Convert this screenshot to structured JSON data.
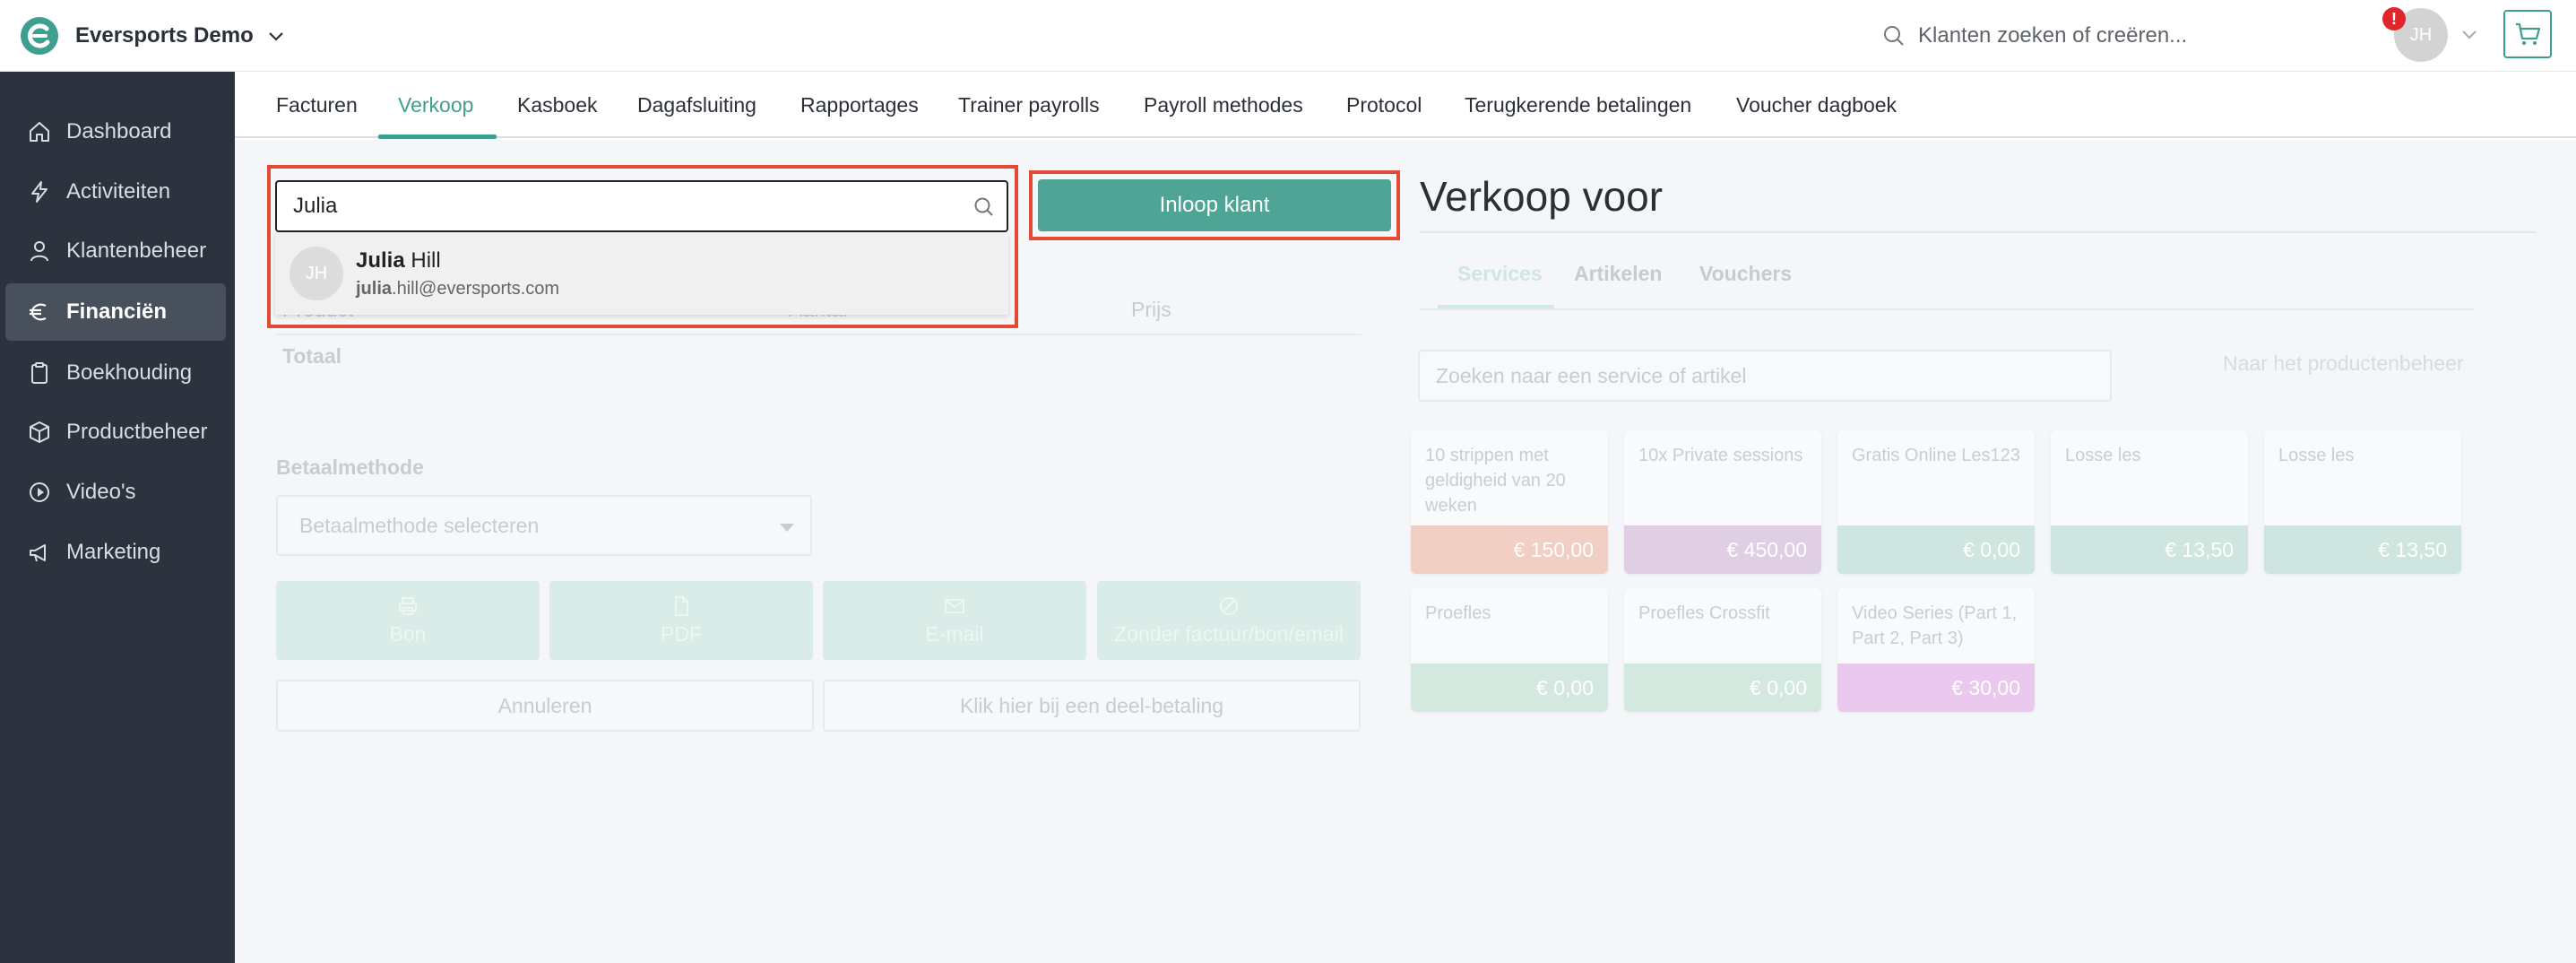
{
  "app": {
    "name": "Eversports Demo",
    "global_search_placeholder": "Klanten zoeken of creëren...",
    "user_initials": "JH",
    "notification_badge": "!",
    "brand_color": "#3f9f8f"
  },
  "sidebar": {
    "items": [
      {
        "label": "Dashboard",
        "icon": "home-icon",
        "active": false
      },
      {
        "label": "Activiteiten",
        "icon": "lightning-icon",
        "active": false
      },
      {
        "label": "Klantenbeheer",
        "icon": "user-icon",
        "active": false
      },
      {
        "label": "Financiën",
        "icon": "euro-icon",
        "active": true
      },
      {
        "label": "Boekhouding",
        "icon": "clipboard-icon",
        "active": false
      },
      {
        "label": "Productbeheer",
        "icon": "box-icon",
        "active": false
      },
      {
        "label": "Video's",
        "icon": "play-circle-icon",
        "active": false
      },
      {
        "label": "Marketing",
        "icon": "megaphone-icon",
        "active": false
      }
    ]
  },
  "tabs": [
    {
      "label": "Facturen",
      "active": false
    },
    {
      "label": "Verkoop",
      "active": true
    },
    {
      "label": "Kasboek",
      "active": false
    },
    {
      "label": "Dagafsluiting",
      "active": false
    },
    {
      "label": "Rapportages",
      "active": false
    },
    {
      "label": "Trainer payrolls",
      "active": false
    },
    {
      "label": "Payroll methodes",
      "active": false
    },
    {
      "label": "Protocol",
      "active": false
    },
    {
      "label": "Terugkerende betalingen",
      "active": false
    },
    {
      "label": "Voucher dagboek",
      "active": false
    }
  ],
  "customer_search": {
    "value": "Julia",
    "result": {
      "initials": "JH",
      "first_name": "Julia",
      "last_name": " Hill",
      "email_match": "julia",
      "email_rest": ".hill@eversports.com"
    }
  },
  "inloop_button": "Inloop klant",
  "cart_table": {
    "columns": [
      "Product",
      "Aantal",
      "Prijs"
    ],
    "total_label": "Totaal"
  },
  "payment": {
    "label": "Betaalmethode",
    "select_placeholder": "Betaalmethode selecteren"
  },
  "action_buttons": [
    {
      "label": "Bon",
      "icon": "printer-icon"
    },
    {
      "label": "PDF",
      "icon": "file-icon"
    },
    {
      "label": "E-mail",
      "icon": "mail-icon"
    },
    {
      "label": "Zonder factuur/bon/email",
      "icon": "ban-icon"
    }
  ],
  "cancel_button": "Annuleren",
  "partial_payment_button": "Klik hier bij een deel-betaling",
  "sale_panel": {
    "title": "Verkoop voor",
    "tabs": [
      "Services",
      "Artikelen",
      "Vouchers"
    ],
    "search_placeholder": "Zoeken naar een service of artikel",
    "product_link": "Naar het productenbeheer",
    "products": [
      {
        "name": "10 strippen met geldigheid van 20 weken",
        "price": "€ 150,00",
        "color": "#f1cfc4"
      },
      {
        "name": "10x Private sessions",
        "price": "€ 450,00",
        "color": "#e0cfe4"
      },
      {
        "name": "Gratis Online Les123",
        "price": "€ 0,00",
        "color": "#cfe5e0"
      },
      {
        "name": "Losse les",
        "price": "€ 13,50",
        "color": "#cfe5e0"
      },
      {
        "name": "Losse les",
        "price": "€ 13,50",
        "color": "#cfe5e0"
      },
      {
        "name": "Proefles",
        "price": "€ 0,00",
        "color": "#d3e9df"
      },
      {
        "name": "Proefles Crossfit",
        "price": "€ 0,00",
        "color": "#d3e9df"
      },
      {
        "name": "Video Series (Part 1, Part 2, Part 3)",
        "price": "€ 30,00",
        "color": "#ebc9ee"
      }
    ]
  }
}
